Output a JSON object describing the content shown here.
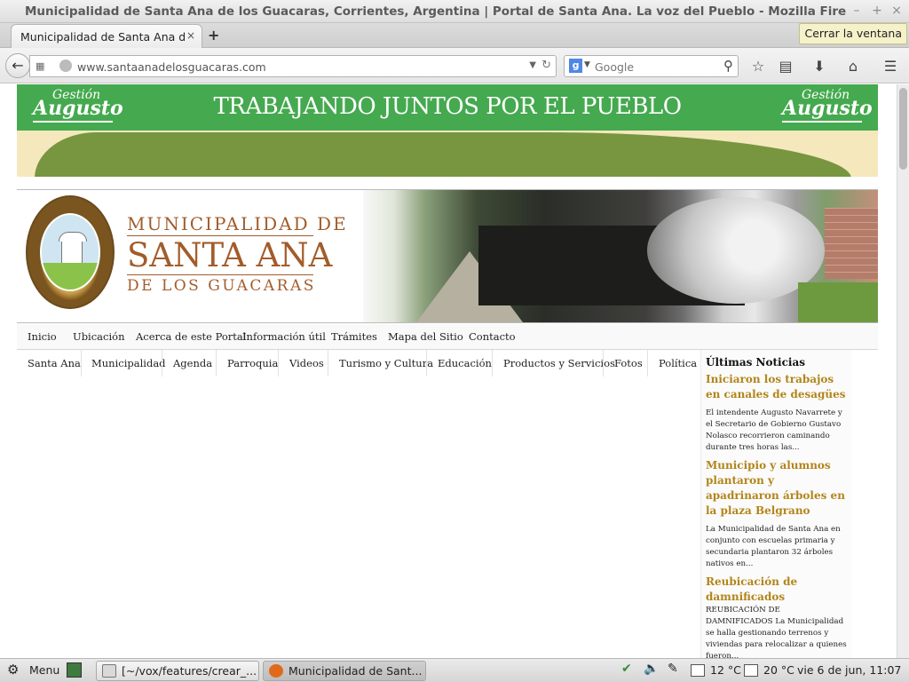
{
  "window": {
    "title": "Municipalidad de Santa Ana de los Guacaras, Corrientes, Argentina | Portal de Santa Ana. La voz del Pueblo - Mozilla Firefox",
    "minimize": "–",
    "maximize": "+",
    "close": "×"
  },
  "tabs": {
    "active_label": "Municipalidad de Santa Ana d...",
    "close": "×",
    "new_tab": "+",
    "tooltip": "Cerrar la ventana"
  },
  "navbar": {
    "url": "www.santaanadelosguacaras.com",
    "search_placeholder": "Google",
    "search_engine_letter": "g"
  },
  "banner": {
    "slogan": "TRABAJANDO JUNTOS POR EL PUEBLO",
    "logo_line1": "Gestión",
    "logo_line2": "Augusto"
  },
  "header": {
    "name_line1": "MUNICIPALIDAD DE",
    "name_line2": "SANTA ANA",
    "name_line3": "DE LOS GUACARAS"
  },
  "main_nav": [
    "Inicio",
    "Ubicación",
    "Acerca de este Portal",
    "Información útil",
    "Trámites",
    "Mapa del Sitio",
    "Contacto"
  ],
  "sub_nav": [
    "Santa Ana",
    "Municipalidad",
    "Agenda",
    "Parroquia",
    "Videos",
    "Turismo y Cultura",
    "Educación",
    "Productos y Servicios",
    "Fotos",
    "Política"
  ],
  "sidebar": {
    "title": "Últimas Noticias",
    "news": [
      {
        "headline": "Iniciaron los trabajos en canales de desagües",
        "summary": "El intendente Augusto Navarrete y el Secretario de Gobierno Gustavo Nolasco recorrieron caminando durante tres horas las..."
      },
      {
        "headline": "Municipio y alumnos plantaron y apadrinaron árboles en la plaza Belgrano",
        "summary": "La Municipalidad de Santa Ana en conjunto con escuelas primaria y secundaria plantaron 32 árboles nativos en..."
      },
      {
        "headline": "Reubicación de damnificados",
        "summary": "REUBICACIÓN DE DAMNIFICADOS La Municipalidad se halla gestionando terrenos y viviendas para relocalizar a quienes fueron..."
      }
    ]
  },
  "taskbar": {
    "menu": "Menu",
    "tasks": [
      "[~/vox/features/crear_...",
      "Municipalidad de Sant..."
    ],
    "temp1": "12 °C",
    "temp2": "20 °C",
    "clock": "vie  6 de jun, 11:07"
  },
  "colors": {
    "banner_green": "#45a94f",
    "banner_olive": "#77963f",
    "brand_brown": "#a25c2b",
    "news_headline": "#b2851a"
  }
}
